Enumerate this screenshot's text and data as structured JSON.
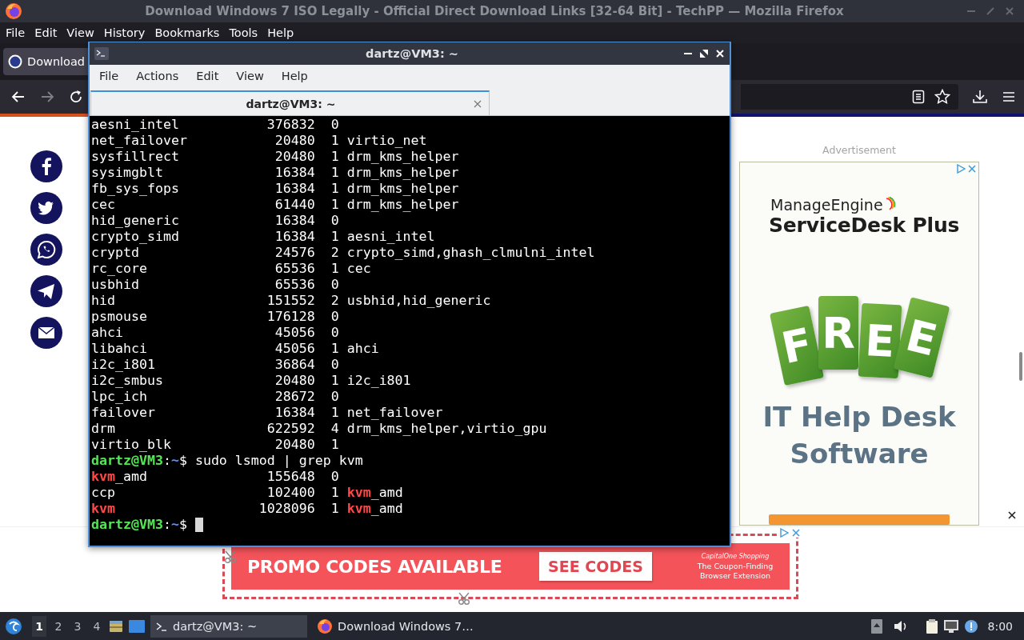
{
  "browser": {
    "title": "Download Windows 7 ISO Legally - Official Direct Download Links [32-64 Bit] - TechPP — Mozilla Firefox",
    "menu": [
      {
        "label": "File"
      },
      {
        "label": "Edit"
      },
      {
        "label": "View"
      },
      {
        "label": "History"
      },
      {
        "label": "Bookmarks"
      },
      {
        "label": "Tools"
      },
      {
        "label": "Help"
      }
    ],
    "tabs": [
      {
        "label": "Download",
        "selected": true
      }
    ],
    "back": {
      "disabled": false
    },
    "forward": {
      "disabled": true
    }
  },
  "page": {
    "ad_label": "Advertisement",
    "side_ad": {
      "brand": "ManageEngine",
      "product": "ServiceDesk Plus",
      "tag_letters": [
        "F",
        "R",
        "E",
        "E"
      ],
      "headline": [
        "IT Help Desk",
        "Software"
      ]
    },
    "banner": {
      "headline": "PROMO CODES AVAILABLE",
      "button": "SEE CODES",
      "brand": "CapitalOne Shopping",
      "tagline": "The Coupon-Finding Browser Extension"
    }
  },
  "terminal": {
    "title": "dartz@VM3: ~",
    "menu": [
      "File",
      "Actions",
      "Edit",
      "View",
      "Help"
    ],
    "tabs": [
      {
        "label": "dartz@VM3: ~",
        "selected": true
      }
    ],
    "lines": [
      {
        "kind": "module",
        "module": "aesni_intel",
        "size": "376832",
        "used": "0"
      },
      {
        "kind": "module",
        "module": "net_failover",
        "size": "20480",
        "used": "1",
        "by": "virtio_net"
      },
      {
        "kind": "module",
        "module": "sysfillrect",
        "size": "20480",
        "used": "1",
        "by": "drm_kms_helper"
      },
      {
        "kind": "module",
        "module": "sysimgblt",
        "size": "16384",
        "used": "1",
        "by": "drm_kms_helper"
      },
      {
        "kind": "module",
        "module": "fb_sys_fops",
        "size": "16384",
        "used": "1",
        "by": "drm_kms_helper"
      },
      {
        "kind": "module",
        "module": "cec",
        "size": "61440",
        "used": "1",
        "by": "drm_kms_helper"
      },
      {
        "kind": "module",
        "module": "hid_generic",
        "size": "16384",
        "used": "0"
      },
      {
        "kind": "module",
        "module": "crypto_simd",
        "size": "16384",
        "used": "1",
        "by": "aesni_intel"
      },
      {
        "kind": "module",
        "module": "cryptd",
        "size": "24576",
        "used": "2",
        "by": "crypto_simd,ghash_clmulni_intel"
      },
      {
        "kind": "module",
        "module": "rc_core",
        "size": "65536",
        "used": "1",
        "by": "cec"
      },
      {
        "kind": "module",
        "module": "usbhid",
        "size": "65536",
        "used": "0"
      },
      {
        "kind": "module",
        "module": "hid",
        "size": "151552",
        "used": "2",
        "by": "usbhid,hid_generic"
      },
      {
        "kind": "module",
        "module": "psmouse",
        "size": "176128",
        "used": "0"
      },
      {
        "kind": "module",
        "module": "ahci",
        "size": "45056",
        "used": "0"
      },
      {
        "kind": "module",
        "module": "libahci",
        "size": "45056",
        "used": "1",
        "by": "ahci"
      },
      {
        "kind": "module",
        "module": "i2c_i801",
        "size": "36864",
        "used": "0"
      },
      {
        "kind": "module",
        "module": "i2c_smbus",
        "size": "20480",
        "used": "1",
        "by": "i2c_i801"
      },
      {
        "kind": "module",
        "module": "lpc_ich",
        "size": "28672",
        "used": "0"
      },
      {
        "kind": "module",
        "module": "failover",
        "size": "16384",
        "used": "1",
        "by": "net_failover"
      },
      {
        "kind": "module",
        "module": "drm",
        "size": "622592",
        "used": "4",
        "by": "drm_kms_helper,virtio_gpu"
      },
      {
        "kind": "module",
        "module": "virtio_blk",
        "size": "20480",
        "used": "1"
      },
      {
        "kind": "prompt",
        "user": "dartz@VM3",
        "sep": ":",
        "path": "~",
        "symbol": "$",
        "command": "sudo lsmod | grep kvm",
        "cursor": false
      },
      {
        "kind": "module",
        "module": [
          {
            "text": "kvm",
            "match": true
          },
          {
            "text": "_amd",
            "match": false
          }
        ],
        "size": "155648",
        "used": "0"
      },
      {
        "kind": "module",
        "module": "ccp",
        "size": "102400",
        "used": "1",
        "by": [
          {
            "text": "kvm",
            "match": true
          },
          {
            "text": "_amd",
            "match": false
          }
        ]
      },
      {
        "kind": "module",
        "module": [
          {
            "text": "kvm",
            "match": true
          }
        ],
        "size": "1028096",
        "used": "1",
        "by": [
          {
            "text": "kvm",
            "match": true
          },
          {
            "text": "_amd",
            "match": false
          }
        ]
      },
      {
        "kind": "prompt",
        "user": "dartz@VM3",
        "sep": ":",
        "path": "~",
        "symbol": "$",
        "cursor": true
      }
    ]
  },
  "taskbar": {
    "workspaces": [
      {
        "label": "1",
        "selected": true
      },
      {
        "label": "2",
        "selected": false
      },
      {
        "label": "3",
        "selected": false
      },
      {
        "label": "4",
        "selected": false
      }
    ],
    "tasks": [
      {
        "kind": "terminal",
        "label": "dartz@VM3: ~",
        "selected": true
      },
      {
        "kind": "browser",
        "label": "Download Windows 7…",
        "selected": false
      }
    ],
    "clock": "8:00"
  }
}
